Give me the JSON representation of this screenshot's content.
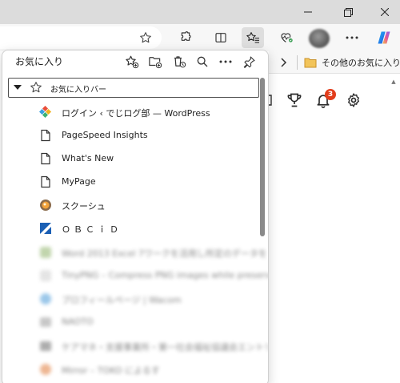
{
  "window": {
    "controls": [
      "minimize-icon",
      "restore-icon",
      "close-icon"
    ]
  },
  "toolbar": {
    "icons": [
      "star-outline-icon",
      "extensions-icon",
      "split-screen-icon",
      "favorites-icon",
      "health-heart-icon",
      "more-icon",
      "copilot-icon"
    ]
  },
  "favorites_bar": {
    "chevron": "›",
    "other_favorites": "その他のお気に入り"
  },
  "page": {
    "notification_count": "3"
  },
  "panel": {
    "title": "お気に入り",
    "tools": [
      "add-favorite-icon",
      "add-folder-icon",
      "delete-history-icon",
      "search-icon",
      "more-icon",
      "pin-icon"
    ],
    "folder": {
      "label": "お気に入りバー",
      "expanded": true
    },
    "items": [
      {
        "label": "ログイン ‹ でじログ部 — WordPress",
        "icon": "wordpress-diamond-icon"
      },
      {
        "label": "PageSpeed Insights",
        "icon": "page-icon"
      },
      {
        "label": "What's New",
        "icon": "page-icon"
      },
      {
        "label": "MyPage",
        "icon": "page-icon"
      },
      {
        "label": "スクーシュ",
        "icon": "orange-avatar-icon"
      },
      {
        "label": "ＯＢＣｉＤ",
        "icon": "obcid-logo-icon"
      },
      {
        "label": "Word 2013 Excel 7ワークを活用し所定のデータを",
        "icon": "blurred-icon",
        "blurred": true
      },
      {
        "label": "TinyPNG – Compress PNG images while preserving",
        "icon": "blurred-icon",
        "blurred": true
      },
      {
        "label": "プロフィールページ | Wacom",
        "icon": "blurred-icon",
        "blurred": true
      },
      {
        "label": "NAOTO",
        "icon": "blurred-icon",
        "blurred": true
      },
      {
        "label": "ケアマネ・支援事業所・第一社会福祉協議会エントリー",
        "icon": "blurred-icon",
        "blurred": true
      },
      {
        "label": "Mirror – TOKO によるす",
        "icon": "blurred-icon",
        "blurred": true
      }
    ]
  },
  "colors": {
    "titlebar": "#dcdcdc",
    "toolbar": "#f7f7f7",
    "badge": "#e23d1c",
    "folder": "#f2b33d"
  }
}
